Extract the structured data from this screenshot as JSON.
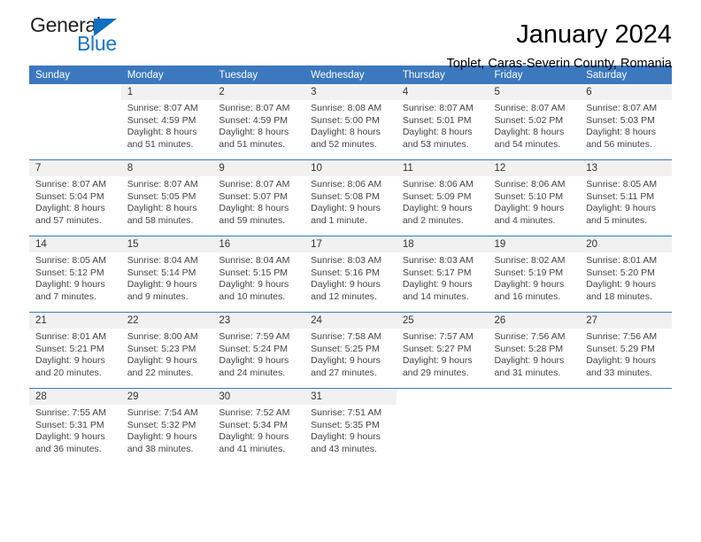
{
  "brand": {
    "name_part1": "General",
    "name_part2": "Blue",
    "triangle_color": "#0f6fc0",
    "blue_color": "#1476c6"
  },
  "header": {
    "month_title": "January 2024",
    "location": "Toplet, Caras-Severin County, Romania"
  },
  "theme": {
    "header_bg": "#3b78bd",
    "daynum_bg": "#f1f1f1",
    "text": "#444444"
  },
  "weekday_headers": [
    "Sunday",
    "Monday",
    "Tuesday",
    "Wednesday",
    "Thursday",
    "Friday",
    "Saturday"
  ],
  "weeks": [
    [
      {
        "day": "",
        "sunrise": "",
        "sunset": "",
        "daylight": ""
      },
      {
        "day": "1",
        "sunrise": "Sunrise: 8:07 AM",
        "sunset": "Sunset: 4:59 PM",
        "daylight": "Daylight: 8 hours and 51 minutes."
      },
      {
        "day": "2",
        "sunrise": "Sunrise: 8:07 AM",
        "sunset": "Sunset: 4:59 PM",
        "daylight": "Daylight: 8 hours and 51 minutes."
      },
      {
        "day": "3",
        "sunrise": "Sunrise: 8:08 AM",
        "sunset": "Sunset: 5:00 PM",
        "daylight": "Daylight: 8 hours and 52 minutes."
      },
      {
        "day": "4",
        "sunrise": "Sunrise: 8:07 AM",
        "sunset": "Sunset: 5:01 PM",
        "daylight": "Daylight: 8 hours and 53 minutes."
      },
      {
        "day": "5",
        "sunrise": "Sunrise: 8:07 AM",
        "sunset": "Sunset: 5:02 PM",
        "daylight": "Daylight: 8 hours and 54 minutes."
      },
      {
        "day": "6",
        "sunrise": "Sunrise: 8:07 AM",
        "sunset": "Sunset: 5:03 PM",
        "daylight": "Daylight: 8 hours and 56 minutes."
      }
    ],
    [
      {
        "day": "7",
        "sunrise": "Sunrise: 8:07 AM",
        "sunset": "Sunset: 5:04 PM",
        "daylight": "Daylight: 8 hours and 57 minutes."
      },
      {
        "day": "8",
        "sunrise": "Sunrise: 8:07 AM",
        "sunset": "Sunset: 5:05 PM",
        "daylight": "Daylight: 8 hours and 58 minutes."
      },
      {
        "day": "9",
        "sunrise": "Sunrise: 8:07 AM",
        "sunset": "Sunset: 5:07 PM",
        "daylight": "Daylight: 8 hours and 59 minutes."
      },
      {
        "day": "10",
        "sunrise": "Sunrise: 8:06 AM",
        "sunset": "Sunset: 5:08 PM",
        "daylight": "Daylight: 9 hours and 1 minute."
      },
      {
        "day": "11",
        "sunrise": "Sunrise: 8:06 AM",
        "sunset": "Sunset: 5:09 PM",
        "daylight": "Daylight: 9 hours and 2 minutes."
      },
      {
        "day": "12",
        "sunrise": "Sunrise: 8:06 AM",
        "sunset": "Sunset: 5:10 PM",
        "daylight": "Daylight: 9 hours and 4 minutes."
      },
      {
        "day": "13",
        "sunrise": "Sunrise: 8:05 AM",
        "sunset": "Sunset: 5:11 PM",
        "daylight": "Daylight: 9 hours and 5 minutes."
      }
    ],
    [
      {
        "day": "14",
        "sunrise": "Sunrise: 8:05 AM",
        "sunset": "Sunset: 5:12 PM",
        "daylight": "Daylight: 9 hours and 7 minutes."
      },
      {
        "day": "15",
        "sunrise": "Sunrise: 8:04 AM",
        "sunset": "Sunset: 5:14 PM",
        "daylight": "Daylight: 9 hours and 9 minutes."
      },
      {
        "day": "16",
        "sunrise": "Sunrise: 8:04 AM",
        "sunset": "Sunset: 5:15 PM",
        "daylight": "Daylight: 9 hours and 10 minutes."
      },
      {
        "day": "17",
        "sunrise": "Sunrise: 8:03 AM",
        "sunset": "Sunset: 5:16 PM",
        "daylight": "Daylight: 9 hours and 12 minutes."
      },
      {
        "day": "18",
        "sunrise": "Sunrise: 8:03 AM",
        "sunset": "Sunset: 5:17 PM",
        "daylight": "Daylight: 9 hours and 14 minutes."
      },
      {
        "day": "19",
        "sunrise": "Sunrise: 8:02 AM",
        "sunset": "Sunset: 5:19 PM",
        "daylight": "Daylight: 9 hours and 16 minutes."
      },
      {
        "day": "20",
        "sunrise": "Sunrise: 8:01 AM",
        "sunset": "Sunset: 5:20 PM",
        "daylight": "Daylight: 9 hours and 18 minutes."
      }
    ],
    [
      {
        "day": "21",
        "sunrise": "Sunrise: 8:01 AM",
        "sunset": "Sunset: 5:21 PM",
        "daylight": "Daylight: 9 hours and 20 minutes."
      },
      {
        "day": "22",
        "sunrise": "Sunrise: 8:00 AM",
        "sunset": "Sunset: 5:23 PM",
        "daylight": "Daylight: 9 hours and 22 minutes."
      },
      {
        "day": "23",
        "sunrise": "Sunrise: 7:59 AM",
        "sunset": "Sunset: 5:24 PM",
        "daylight": "Daylight: 9 hours and 24 minutes."
      },
      {
        "day": "24",
        "sunrise": "Sunrise: 7:58 AM",
        "sunset": "Sunset: 5:25 PM",
        "daylight": "Daylight: 9 hours and 27 minutes."
      },
      {
        "day": "25",
        "sunrise": "Sunrise: 7:57 AM",
        "sunset": "Sunset: 5:27 PM",
        "daylight": "Daylight: 9 hours and 29 minutes."
      },
      {
        "day": "26",
        "sunrise": "Sunrise: 7:56 AM",
        "sunset": "Sunset: 5:28 PM",
        "daylight": "Daylight: 9 hours and 31 minutes."
      },
      {
        "day": "27",
        "sunrise": "Sunrise: 7:56 AM",
        "sunset": "Sunset: 5:29 PM",
        "daylight": "Daylight: 9 hours and 33 minutes."
      }
    ],
    [
      {
        "day": "28",
        "sunrise": "Sunrise: 7:55 AM",
        "sunset": "Sunset: 5:31 PM",
        "daylight": "Daylight: 9 hours and 36 minutes."
      },
      {
        "day": "29",
        "sunrise": "Sunrise: 7:54 AM",
        "sunset": "Sunset: 5:32 PM",
        "daylight": "Daylight: 9 hours and 38 minutes."
      },
      {
        "day": "30",
        "sunrise": "Sunrise: 7:52 AM",
        "sunset": "Sunset: 5:34 PM",
        "daylight": "Daylight: 9 hours and 41 minutes."
      },
      {
        "day": "31",
        "sunrise": "Sunrise: 7:51 AM",
        "sunset": "Sunset: 5:35 PM",
        "daylight": "Daylight: 9 hours and 43 minutes."
      },
      {
        "day": "",
        "sunrise": "",
        "sunset": "",
        "daylight": ""
      },
      {
        "day": "",
        "sunrise": "",
        "sunset": "",
        "daylight": ""
      },
      {
        "day": "",
        "sunrise": "",
        "sunset": "",
        "daylight": ""
      }
    ]
  ]
}
